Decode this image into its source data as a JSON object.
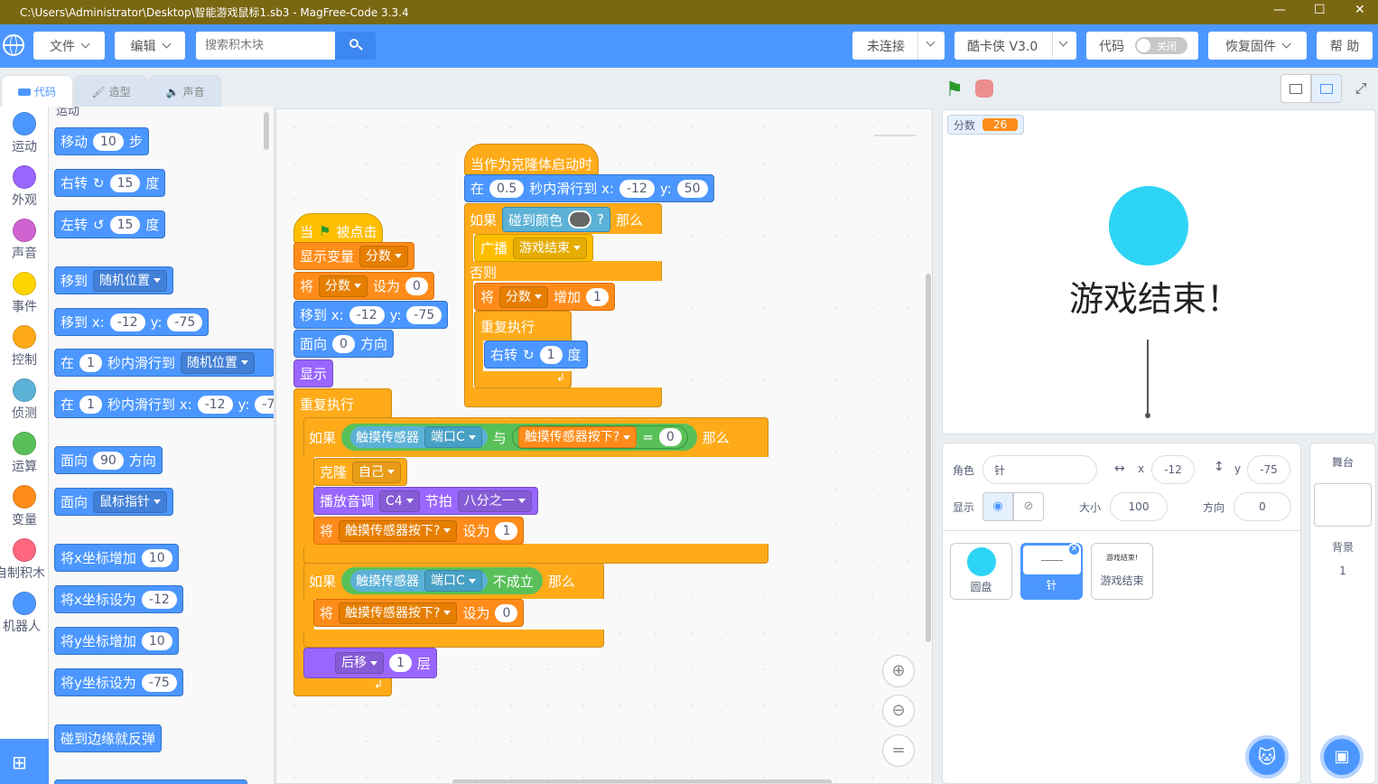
{
  "window": {
    "title": "C:\\Users\\Administrator\\Desktop\\智能游戏鼠标1.sb3 - MagFree-Code 3.3.4"
  },
  "menu": {
    "file": "文件",
    "edit": "编辑",
    "search_placeholder": "搜索积木块",
    "connection": "未连接",
    "device": "酷卡侠 V3.0",
    "code": "代码",
    "code_toggle": "关闭",
    "restore": "恢复固件",
    "help": "帮 助"
  },
  "tabs": {
    "code": "代码",
    "costume": "造型",
    "sound": "声音"
  },
  "categories": [
    {
      "label": "运动",
      "color": "#4c97ff"
    },
    {
      "label": "外观",
      "color": "#9966ff"
    },
    {
      "label": "声音",
      "color": "#cf63cf"
    },
    {
      "label": "事件",
      "color": "#ffd500"
    },
    {
      "label": "控制",
      "color": "#ffab19"
    },
    {
      "label": "侦测",
      "color": "#5cb1d6"
    },
    {
      "label": "运算",
      "color": "#59c059"
    },
    {
      "label": "变量",
      "color": "#ff8c1a"
    },
    {
      "label": "自制积木",
      "color": "#ff6680"
    },
    {
      "label": "机器人",
      "color": "#4c97ff"
    }
  ],
  "palette": {
    "section": "运动",
    "move": {
      "a": "移动",
      "v": "10",
      "b": "步"
    },
    "turn_right": {
      "a": "右转",
      "v": "15",
      "b": "度"
    },
    "turn_left": {
      "a": "左转",
      "v": "15",
      "b": "度"
    },
    "goto": {
      "a": "移到",
      "dd": "随机位置"
    },
    "goto_xy": {
      "a": "移到 x:",
      "x": "-12",
      "yl": "y:",
      "y": "-75"
    },
    "glide_to": {
      "a": "在",
      "v": "1",
      "b": "秒内滑行到",
      "dd": "随机位置"
    },
    "glide_xy": {
      "a": "在",
      "v": "1",
      "b": "秒内滑行到 x:",
      "x": "-12",
      "yl": "y:",
      "y": "-7"
    },
    "point_dir": {
      "a": "面向",
      "v": "90",
      "b": "方向"
    },
    "point_towards": {
      "a": "面向",
      "dd": "鼠标指针"
    },
    "change_x": {
      "a": "将x坐标增加",
      "v": "10"
    },
    "set_x": {
      "a": "将x坐标设为",
      "v": "-12"
    },
    "change_y": {
      "a": "将y坐标增加",
      "v": "10"
    },
    "set_y": {
      "a": "将y坐标设为",
      "v": "-75"
    },
    "bounce": {
      "a": "碰到边缘就反弹"
    }
  },
  "script1": {
    "hat": {
      "a": "当",
      "b": "被点击"
    },
    "show_var": {
      "a": "显示变量",
      "dd": "分数"
    },
    "set_var": {
      "a": "将",
      "dd": "分数",
      "b": "设为",
      "v": "0"
    },
    "goto_xy": {
      "a": "移到 x:",
      "x": "-12",
      "yl": "y:",
      "y": "-75"
    },
    "point": {
      "a": "面向",
      "v": "0",
      "b": "方向"
    },
    "show": "显示",
    "forever": "重复执行",
    "if1": {
      "if": "如果",
      "sensor": "触摸传感器",
      "port": "端口C",
      "and": "与",
      "var": "触摸传感器按下?",
      "eq": "=",
      "v": "0",
      "then": "那么"
    },
    "clone": {
      "a": "克隆",
      "dd": "自己"
    },
    "play_note": {
      "a": "播放音调",
      "note": "C4",
      "b": "节拍",
      "beat": "八分之一"
    },
    "set_pressed1": {
      "a": "将",
      "dd": "触摸传感器按下?",
      "b": "设为",
      "v": "1"
    },
    "if2": {
      "if": "如果",
      "sensor": "触摸传感器",
      "port": "端口C",
      "not": "不成立",
      "then": "那么"
    },
    "set_pressed0": {
      "a": "将",
      "dd": "触摸传感器按下?",
      "b": "设为",
      "v": "0"
    },
    "layer": {
      "dd": "后移",
      "v": "1",
      "b": "层"
    }
  },
  "script2": {
    "hat": "当作为克隆体启动时",
    "glide": {
      "a": "在",
      "v": "0.5",
      "b": "秒内滑行到 x:",
      "x": "-12",
      "yl": "y:",
      "y": "50"
    },
    "if": {
      "if": "如果",
      "touch": "碰到颜色",
      "q": "?",
      "then": "那么"
    },
    "broadcast": {
      "a": "广播",
      "dd": "游戏结束"
    },
    "else": "否则",
    "change": {
      "a": "将",
      "dd": "分数",
      "b": "增加",
      "v": "1"
    },
    "forever": "重复执行",
    "turn": {
      "a": "右转",
      "v": "1",
      "b": "度"
    }
  },
  "stage": {
    "monitor_label": "分数",
    "monitor_value": "26",
    "game_over": "游戏结束！"
  },
  "sprite_info": {
    "role_label": "角色",
    "role_name": "针",
    "x_label": "x",
    "x": "-12",
    "y_label": "y",
    "y": "-75",
    "show_label": "显示",
    "size_label": "大小",
    "size": "100",
    "dir_label": "方向",
    "dir": "0"
  },
  "sprites": [
    {
      "name": "圆盘"
    },
    {
      "name": "针"
    },
    {
      "name": "游戏结束",
      "thumb_text": "游戏结束!"
    }
  ],
  "stage_panel": {
    "title": "舞台",
    "backdrop_label": "背景",
    "backdrop_count": "1"
  }
}
